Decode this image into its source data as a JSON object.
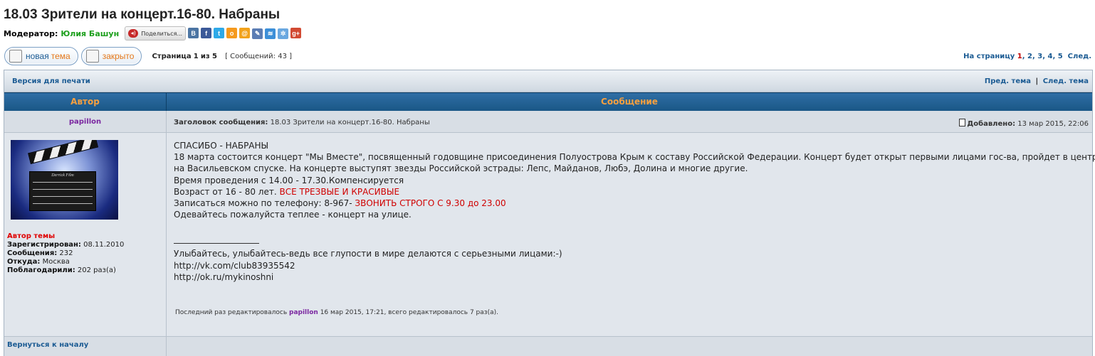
{
  "topic": {
    "title": "18.03 Зрители на концерт.16-80. Набраны"
  },
  "moderator": {
    "label": "Модератор:",
    "name": "Юлия Башун"
  },
  "share": {
    "label": "Поделиться...",
    "icons": [
      {
        "name": "vk-icon",
        "glyph": "B",
        "color": "#4c75a3"
      },
      {
        "name": "facebook-icon",
        "glyph": "f",
        "color": "#3b5998"
      },
      {
        "name": "twitter-icon",
        "glyph": "t",
        "color": "#2ea9e8"
      },
      {
        "name": "odnoklassniki-icon",
        "glyph": "o",
        "color": "#f59a1e"
      },
      {
        "name": "mailru-icon",
        "glyph": "@",
        "color": "#f2a21b"
      },
      {
        "name": "livejournal-icon",
        "glyph": "✎",
        "color": "#5b7db4"
      },
      {
        "name": "liveinternet-icon",
        "glyph": "≋",
        "color": "#3c8fd8"
      },
      {
        "name": "yandex-icon",
        "glyph": "✲",
        "color": "#6aa8e0"
      },
      {
        "name": "googleplus-icon",
        "glyph": "g+",
        "color": "#d24a33"
      }
    ]
  },
  "buttons": {
    "new_topic_1": "новая",
    "new_topic_2": "тема",
    "closed": "закрыто"
  },
  "pagination": {
    "page_label": "Страница",
    "page_current": "1",
    "of_label": "из",
    "page_total": "5",
    "messages": "[ Сообщений: 43 ]",
    "to_page_label": "На страницу",
    "pages": [
      "1",
      "2",
      "3",
      "4",
      "5"
    ],
    "next_label": "След."
  },
  "topbar": {
    "print_version": "Версия для печати",
    "prev_topic": "Пред. тема",
    "separator": "|",
    "next_topic": "След. тема"
  },
  "table_headers": {
    "author": "Автор",
    "message": "Сообщение"
  },
  "post": {
    "author": "papillon",
    "subject_label": "Заголовок сообщения:",
    "subject": "18.03 Зрители на концерт.16-80. Набраны",
    "added_label": "Добавлено:",
    "added_date": "13 мар 2015, 22:06",
    "author_info": {
      "topic_author": "Автор темы",
      "registered_label": "Зарегистрирован:",
      "registered": "08.11.2010",
      "messages_label": "Сообщения:",
      "messages": "232",
      "from_label": "Откуда:",
      "from": "Москва",
      "thanked_label": "Поблагодарили:",
      "thanked": "202 раз(а)"
    },
    "avatar_caption": "Derrick Film",
    "body": {
      "l1": "СПАСИБО - НАБРАНЫ",
      "l2": "18 марта состоится концерт \"Мы Вместе\", посвященный годовщине присоединения Полуострова Крым к составу Российской Федерации. Концерт будет открыт первыми лицами гос-ва, пройдет в центре Москвы",
      "l3": "на Васильевском спуске. На концерте выступят звезды Российской эстрады: Лепс, Майданов, Любэ, Долина и многие другие.",
      "l4": "Время проведения с 14.00 - 17.30.Компенсируется",
      "l5a": "Возраст от 16 - 80 лет. ",
      "l5b": "ВСЕ ТРЕЗВЫЕ И КРАСИВЫЕ",
      "l6a": "Записаться можно по телефону: 8-967- ",
      "l6b": "ЗВОНИТЬ СТРОГО С 9.30 до 23.00",
      "l7": "Одевайтесь пожалуйста теплее - концерт на улице."
    },
    "signature": {
      "s1": "Улыбайтесь, улыбайтесь-ведь все глупости в мире делаются с серьезными лицами:-)",
      "s2": "http://vk.com/club83935542",
      "s3": "http://ok.ru/mykinoshni"
    },
    "edited": {
      "prefix": "Последний раз редактировалось",
      "user": "papillon",
      "suffix": "16 мар 2015, 17:21, всего редактировалось 7 раз(а)."
    }
  },
  "footer": {
    "back_to_top": "Вернуться к началу"
  }
}
